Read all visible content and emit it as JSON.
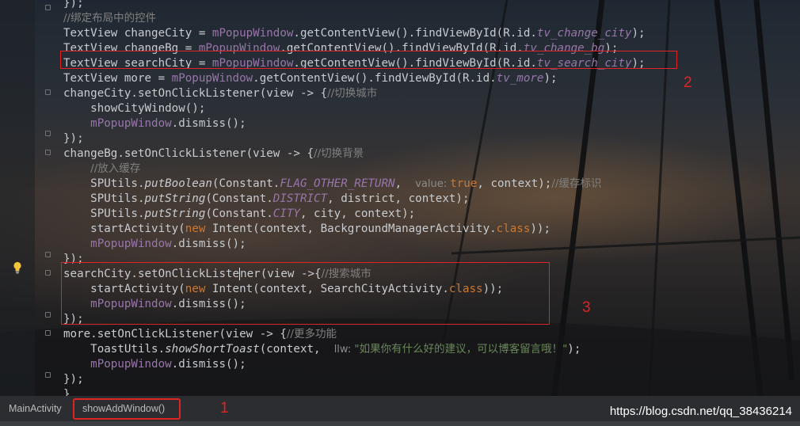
{
  "code_lines": [
    {
      "id": "l0",
      "segs": [
        [
          "});",
          ""
        ]
      ]
    },
    {
      "id": "l1",
      "segs": [
        [
          "//绑定布局中的控件",
          "cm"
        ]
      ]
    },
    {
      "id": "l2",
      "segs": [
        [
          "TextView changeCity = ",
          ""
        ],
        [
          "mPopupWindow",
          "fld"
        ],
        [
          ".getContentView().findViewById(R.id.",
          ""
        ],
        [
          "tv_change_city",
          "fldi"
        ],
        [
          ");",
          ""
        ]
      ]
    },
    {
      "id": "l3",
      "segs": [
        [
          "TextView changeBg = ",
          ""
        ],
        [
          "mPopupWindow",
          "fld"
        ],
        [
          ".getContentView().findViewById(R.id.",
          ""
        ],
        [
          "tv_change_bg",
          "fldi"
        ],
        [
          ");",
          ""
        ]
      ]
    },
    {
      "id": "l4",
      "segs": [
        [
          "TextView searchCity = ",
          ""
        ],
        [
          "mPopupWindow",
          "fld"
        ],
        [
          ".getContentView().findViewById(R.id.",
          ""
        ],
        [
          "tv_search_city",
          "fldi"
        ],
        [
          ");",
          ""
        ]
      ]
    },
    {
      "id": "l5",
      "segs": [
        [
          "TextView more = ",
          ""
        ],
        [
          "mPopupWindow",
          "fld"
        ],
        [
          ".getContentView().findViewById(R.id.",
          ""
        ],
        [
          "tv_more",
          "fldi"
        ],
        [
          ");",
          ""
        ]
      ]
    },
    {
      "id": "l6",
      "segs": [
        [
          "changeCity.setOnClickListener(view -> {",
          ""
        ],
        [
          "//切换城市",
          "cm"
        ]
      ]
    },
    {
      "id": "l7",
      "segs": [
        [
          "    showCityWindow();",
          ""
        ]
      ]
    },
    {
      "id": "l8",
      "segs": [
        [
          "    ",
          ""
        ],
        [
          "mPopupWindow",
          "fld"
        ],
        [
          ".dismiss();",
          ""
        ]
      ]
    },
    {
      "id": "l9",
      "segs": [
        [
          "});",
          ""
        ]
      ]
    },
    {
      "id": "l10",
      "segs": [
        [
          "changeBg.setOnClickListener(view -> {",
          ""
        ],
        [
          "//切换背景",
          "cm"
        ]
      ]
    },
    {
      "id": "l11",
      "segs": [
        [
          "    ",
          ""
        ],
        [
          "//放入缓存",
          "cm"
        ]
      ]
    },
    {
      "id": "l12",
      "segs": [
        [
          "    SPUtils.",
          ""
        ],
        [
          "putBoolean",
          "mi"
        ],
        [
          "(Constant.",
          ""
        ],
        [
          "FLAG_OTHER_RETURN",
          "fldi"
        ],
        [
          ",  ",
          ""
        ],
        [
          "value: ",
          "hint"
        ],
        [
          "true",
          "kw"
        ],
        [
          ", context);",
          ""
        ],
        [
          "//缓存标识",
          "cm"
        ]
      ]
    },
    {
      "id": "l13",
      "segs": [
        [
          "    SPUtils.",
          ""
        ],
        [
          "putString",
          "mi"
        ],
        [
          "(Constant.",
          ""
        ],
        [
          "DISTRICT",
          "fldi"
        ],
        [
          ", district, context);",
          ""
        ]
      ]
    },
    {
      "id": "l14",
      "segs": [
        [
          "    SPUtils.",
          ""
        ],
        [
          "putString",
          "mi"
        ],
        [
          "(Constant.",
          ""
        ],
        [
          "CITY",
          "fldi"
        ],
        [
          ", city, context);",
          ""
        ]
      ]
    },
    {
      "id": "l15",
      "segs": [
        [
          "    startActivity(",
          ""
        ],
        [
          "new",
          "kw"
        ],
        [
          " Intent(context, BackgroundManagerActivity.",
          ""
        ],
        [
          "class",
          "kw"
        ],
        [
          "));",
          ""
        ]
      ]
    },
    {
      "id": "l16",
      "segs": [
        [
          "    ",
          ""
        ],
        [
          "mPopupWindow",
          "fld"
        ],
        [
          ".dismiss();",
          ""
        ]
      ]
    },
    {
      "id": "l17",
      "segs": [
        [
          "});",
          ""
        ]
      ]
    },
    {
      "id": "l18",
      "segs": [
        [
          "searchCity.setOnClickListe",
          ""
        ],
        [
          "|cursor",
          "cursor"
        ],
        [
          "ner(view ->{",
          ""
        ],
        [
          "//搜索城市",
          "cm"
        ]
      ]
    },
    {
      "id": "l19",
      "segs": [
        [
          "    startActivity(",
          ""
        ],
        [
          "new",
          "kw"
        ],
        [
          " Intent(context, SearchCityActivity.",
          ""
        ],
        [
          "class",
          "kw"
        ],
        [
          "));",
          ""
        ]
      ]
    },
    {
      "id": "l20",
      "segs": [
        [
          "    ",
          ""
        ],
        [
          "mPopupWindow",
          "fld"
        ],
        [
          ".dismiss();",
          ""
        ]
      ]
    },
    {
      "id": "l21",
      "segs": [
        [
          "});",
          ""
        ]
      ]
    },
    {
      "id": "l22",
      "segs": [
        [
          "more.setOnClickListener(view -> {",
          ""
        ],
        [
          "//更多功能",
          "cm"
        ]
      ]
    },
    {
      "id": "l23",
      "segs": [
        [
          "    ToastUtils.",
          ""
        ],
        [
          "showShortToast",
          "mi"
        ],
        [
          "(context,  ",
          ""
        ],
        [
          "llw: ",
          "hint"
        ],
        [
          "\"如果你有什么好的建议，可以博客留言哦！\"",
          "st"
        ],
        [
          ");",
          ""
        ]
      ]
    },
    {
      "id": "l24",
      "segs": [
        [
          "    ",
          ""
        ],
        [
          "mPopupWindow",
          "fld"
        ],
        [
          ".dismiss();",
          ""
        ]
      ]
    },
    {
      "id": "l25",
      "segs": [
        [
          "});",
          ""
        ]
      ]
    },
    {
      "id": "l26",
      "segs": [
        [
          "}",
          ""
        ]
      ]
    }
  ],
  "annotations": {
    "one": "1",
    "two": "2",
    "three": "3"
  },
  "breadcrumb": {
    "file": "MainActivity",
    "method": "showAddWindow()"
  },
  "watermark": "https://blog.csdn.net/qq_38436214",
  "colors": {
    "annotation_red": "#e02424",
    "keyword": "#cc7832",
    "field": "#9876aa",
    "comment": "#808080",
    "string": "#6a8759"
  },
  "icons": {
    "gutter": "lightbulb-icon"
  }
}
